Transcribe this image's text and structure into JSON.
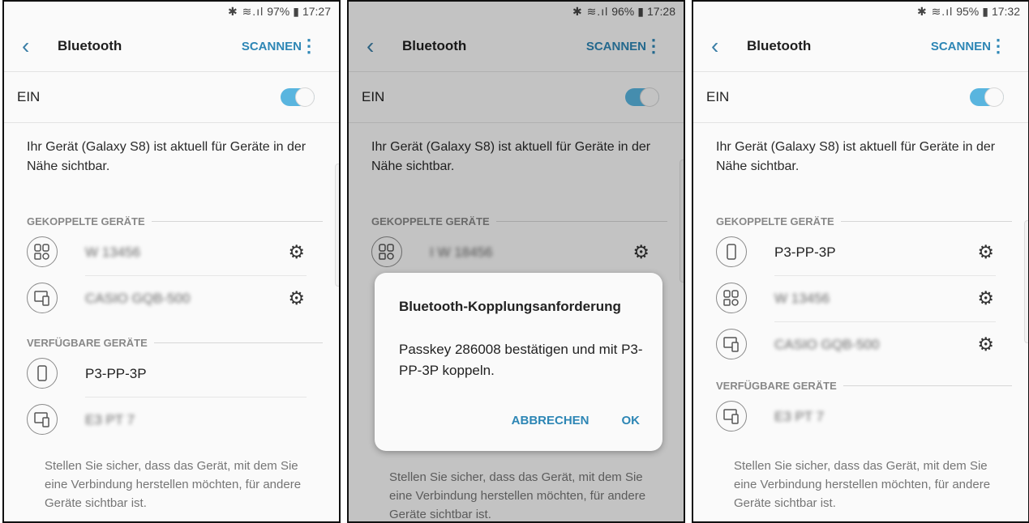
{
  "screens": [
    {
      "status": {
        "icons": "✱ ≋.ıl",
        "battery": "97%",
        "time": "17:27"
      },
      "header": {
        "title": "Bluetooth",
        "scan": "SCANNEN"
      },
      "toggle_label": "EIN",
      "description": "Ihr Gerät (Galaxy S8) ist aktuell für Geräte in der Nähe sichtbar.",
      "paired_header": "GEKOPPELTE GERÄTE",
      "paired": [
        {
          "name": "W 13456",
          "icon": "multi-device-icon"
        },
        {
          "name": "CASIO GQB-500",
          "icon": "tablet-phone-icon"
        }
      ],
      "available_header": "VERFÜGBARE GERÄTE",
      "available": [
        {
          "name": "P3-PP-3P",
          "icon": "phone-icon"
        },
        {
          "name": "E3 PT 7",
          "icon": "tablet-phone-icon"
        }
      ],
      "hint": "Stellen Sie sicher, dass das Gerät, mit dem Sie eine Verbindung herstellen möchten, für andere Geräte sichtbar ist."
    },
    {
      "status": {
        "icons": "✱ ≋.ıl",
        "battery": "96%",
        "time": "17:28"
      },
      "header": {
        "title": "Bluetooth",
        "scan": "SCANNEN"
      },
      "toggle_label": "EIN",
      "description": "Ihr Gerät (Galaxy S8) ist aktuell für Geräte in der Nähe sichtbar.",
      "paired_header": "GEKOPPELTE GERÄTE",
      "paired": [
        {
          "name": "I W 18456",
          "icon": "multi-device-icon"
        }
      ],
      "hint": "Stellen Sie sicher, dass das Gerät, mit dem Sie eine Verbindung herstellen möchten, für andere Geräte sichtbar ist.",
      "dialog": {
        "title": "Bluetooth-Kopplungsanforderung",
        "body": "Passkey 286008 bestätigen und mit P3-PP-3P koppeln.",
        "cancel": "ABBRECHEN",
        "ok": "OK"
      }
    },
    {
      "status": {
        "icons": "✱ ≋.ıl",
        "battery": "95%",
        "time": "17:32"
      },
      "header": {
        "title": "Bluetooth",
        "scan": "SCANNEN"
      },
      "toggle_label": "EIN",
      "description": "Ihr Gerät (Galaxy S8) ist aktuell für Geräte in der Nähe sichtbar.",
      "paired_header": "GEKOPPELTE GERÄTE",
      "paired": [
        {
          "name": "P3-PP-3P",
          "icon": "phone-icon"
        },
        {
          "name": "W 13456",
          "icon": "multi-device-icon"
        },
        {
          "name": "CASIO GQB-500",
          "icon": "tablet-phone-icon"
        }
      ],
      "available_header": "VERFÜGBARE GERÄTE",
      "available": [
        {
          "name": "E3 PT 7",
          "icon": "tablet-phone-icon"
        }
      ],
      "hint": "Stellen Sie sicher, dass das Gerät, mit dem Sie eine Verbindung herstellen möchten, für andere Geräte sichtbar ist."
    }
  ]
}
